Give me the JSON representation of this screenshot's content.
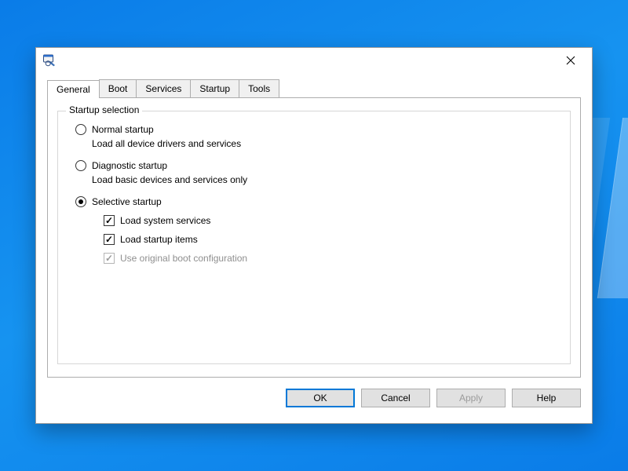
{
  "tabs": [
    "General",
    "Boot",
    "Services",
    "Startup",
    "Tools"
  ],
  "active_tab_index": 0,
  "group": {
    "legend": "Startup selection",
    "options": [
      {
        "title": "Normal startup",
        "desc": "Load all device drivers and services",
        "selected": false
      },
      {
        "title": "Diagnostic startup",
        "desc": "Load basic devices and services only",
        "selected": false
      },
      {
        "title": "Selective startup",
        "desc": "",
        "selected": true,
        "checks": [
          {
            "label": "Load system services",
            "checked": true,
            "enabled": true
          },
          {
            "label": "Load startup items",
            "checked": true,
            "enabled": true
          },
          {
            "label": "Use original boot configuration",
            "checked": true,
            "enabled": false
          }
        ]
      }
    ]
  },
  "buttons": {
    "ok": "OK",
    "cancel": "Cancel",
    "apply": "Apply",
    "help": "Help"
  }
}
